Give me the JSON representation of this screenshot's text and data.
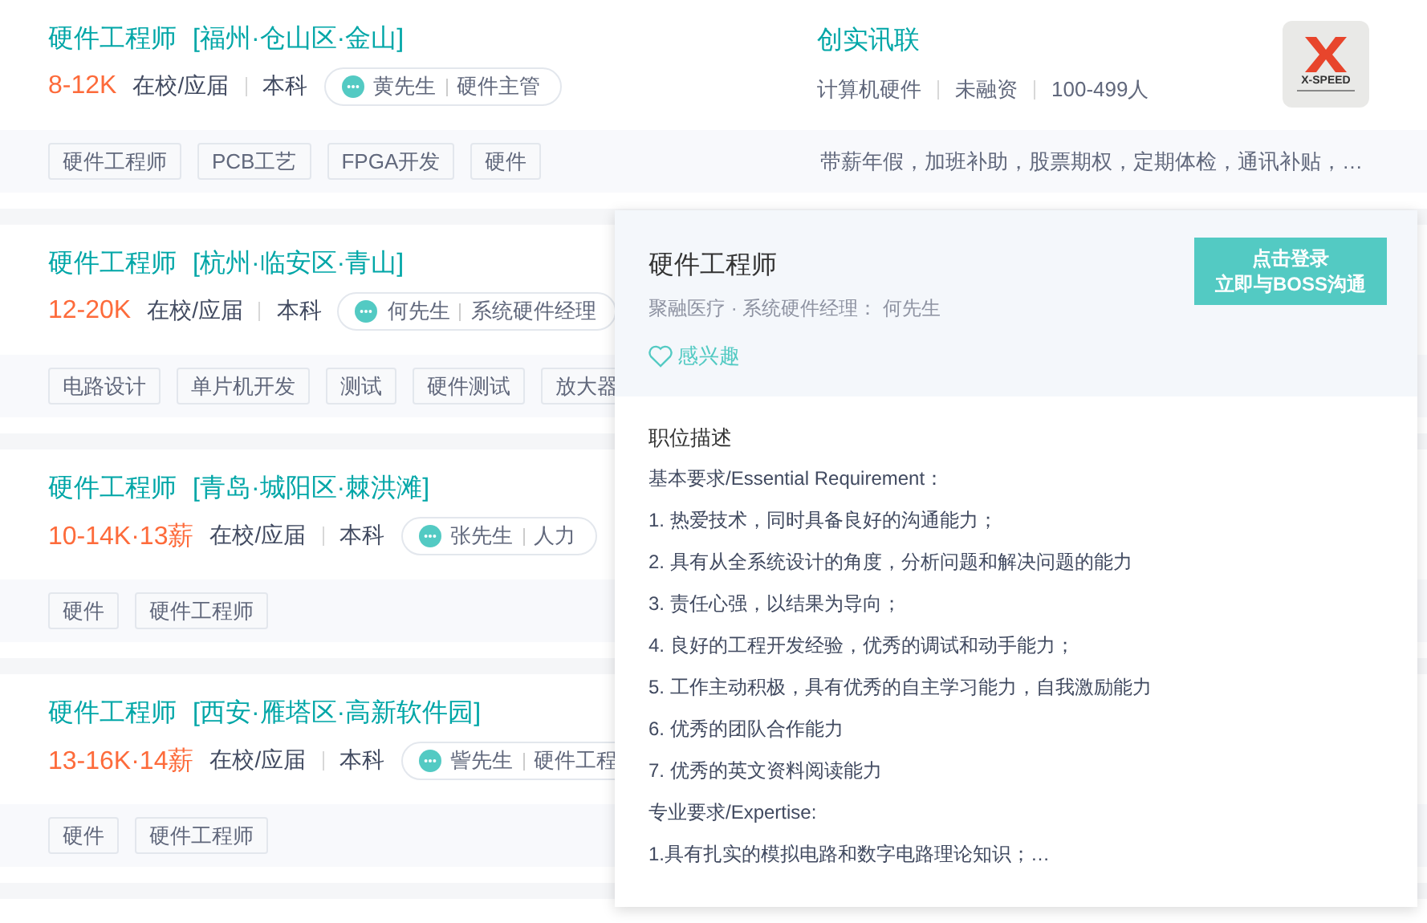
{
  "jobs": [
    {
      "title": "硬件工程师",
      "location": "[福州·仓山区·金山]",
      "salary": "8-12K",
      "requirements": [
        "在校/应届",
        "本科"
      ],
      "recruiter": {
        "name": "黄先生",
        "role": "硬件主管"
      },
      "company": {
        "name": "创实讯联",
        "facts": [
          "计算机硬件",
          "未融资",
          "100-499人"
        ],
        "logo_text": "X-SPEED"
      },
      "tags": [
        "硬件工程师",
        "PCB工艺",
        "FPGA开发",
        "硬件"
      ],
      "benefits": "带薪年假，加班补助，股票期权，定期体检，通讯补贴，…"
    },
    {
      "title": "硬件工程师",
      "location": "[杭州·临安区·青山]",
      "salary": "12-20K",
      "requirements": [
        "在校/应届",
        "本科"
      ],
      "recruiter": {
        "name": "何先生",
        "role": "系统硬件经理"
      },
      "tags": [
        "电路设计",
        "单片机开发",
        "测试",
        "硬件测试",
        "放大器"
      ]
    },
    {
      "title": "硬件工程师",
      "location": "[青岛·城阳区·棘洪滩]",
      "salary": "10-14K·13薪",
      "requirements": [
        "在校/应届",
        "本科"
      ],
      "recruiter": {
        "name": "张先生",
        "role": "人力"
      },
      "tags": [
        "硬件",
        "硬件工程师"
      ]
    },
    {
      "title": "硬件工程师",
      "location": "[西安·雁塔区·高新软件园]",
      "salary": "13-16K·14薪",
      "requirements": [
        "在校/应届",
        "本科"
      ],
      "recruiter": {
        "name": "訾先生",
        "role": "硬件工程"
      },
      "tags": [
        "硬件",
        "硬件工程师"
      ]
    }
  ],
  "detail_popup": {
    "title": "硬件工程师",
    "meta": "聚融医疗 · 系统硬件经理： 何先生",
    "interest": "感兴趣",
    "login_button": [
      "点击登录",
      "立即与BOSS沟通"
    ],
    "section_title": "职位描述",
    "lines": [
      "基本要求/Essential Requirement：",
      "1. 热爱技术，同时具备良好的沟通能力；",
      "2. 具有从全系统设计的角度，分析问题和解决问题的能力",
      "3. 责任心强，以结果为导向；",
      "4. 良好的工程开发经验，优秀的调试和动手能力；",
      "5. 工作主动积极，具有优秀的自主学习能力，自我激励能力",
      "6. 优秀的团队合作能力",
      "7. 优秀的英文资料阅读能力",
      "专业要求/Expertise:",
      "1.具有扎实的模拟电路和数字电路理论知识；…"
    ]
  }
}
